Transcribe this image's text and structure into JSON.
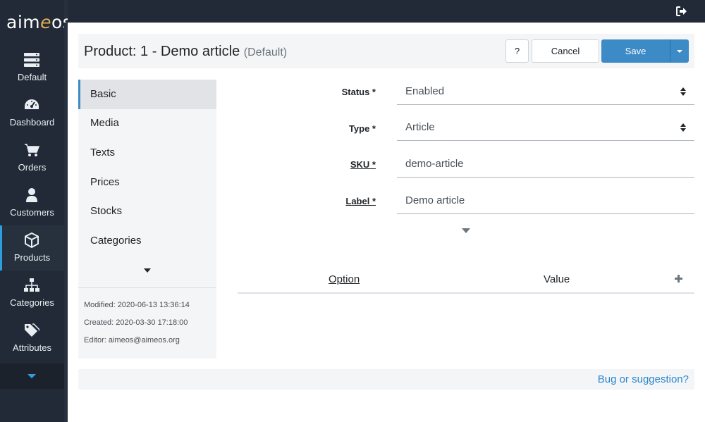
{
  "app": {
    "logo_prefix": "aim",
    "logo_accent": "e",
    "logo_suffix": "os"
  },
  "sidebar": {
    "items": [
      {
        "label": "Default",
        "icon": "server-icon"
      },
      {
        "label": "Dashboard",
        "icon": "dashboard-icon"
      },
      {
        "label": "Orders",
        "icon": "cart-icon"
      },
      {
        "label": "Customers",
        "icon": "user-icon"
      },
      {
        "label": "Products",
        "icon": "box-icon",
        "active": true
      },
      {
        "label": "Categories",
        "icon": "sitemap-icon"
      },
      {
        "label": "Attributes",
        "icon": "tags-icon"
      }
    ]
  },
  "header": {
    "title": "Product: 1 - Demo article",
    "subtitle": "(Default)",
    "help_label": "?",
    "cancel_label": "Cancel",
    "save_label": "Save"
  },
  "tabs": {
    "items": [
      "Basic",
      "Media",
      "Texts",
      "Prices",
      "Stocks",
      "Categories"
    ],
    "active": "Basic"
  },
  "meta": {
    "modified": "Modified: 2020-06-13 13:36:14",
    "created": "Created: 2020-03-30 17:18:00",
    "editor": "Editor: aimeos@aimeos.org"
  },
  "form": {
    "status_label": "Status *",
    "status_value": "Enabled",
    "type_label": "Type *",
    "type_value": "Article",
    "sku_label": "SKU *",
    "sku_value": "demo-article",
    "label_label": "Label *",
    "label_value": "Demo article"
  },
  "properties": {
    "option_header": "Option",
    "value_header": "Value"
  },
  "footer": {
    "link": "Bug or suggestion?"
  },
  "colors": {
    "accent": "#3c8ac6",
    "sidebar": "#212a36",
    "link": "#2a87d0"
  }
}
